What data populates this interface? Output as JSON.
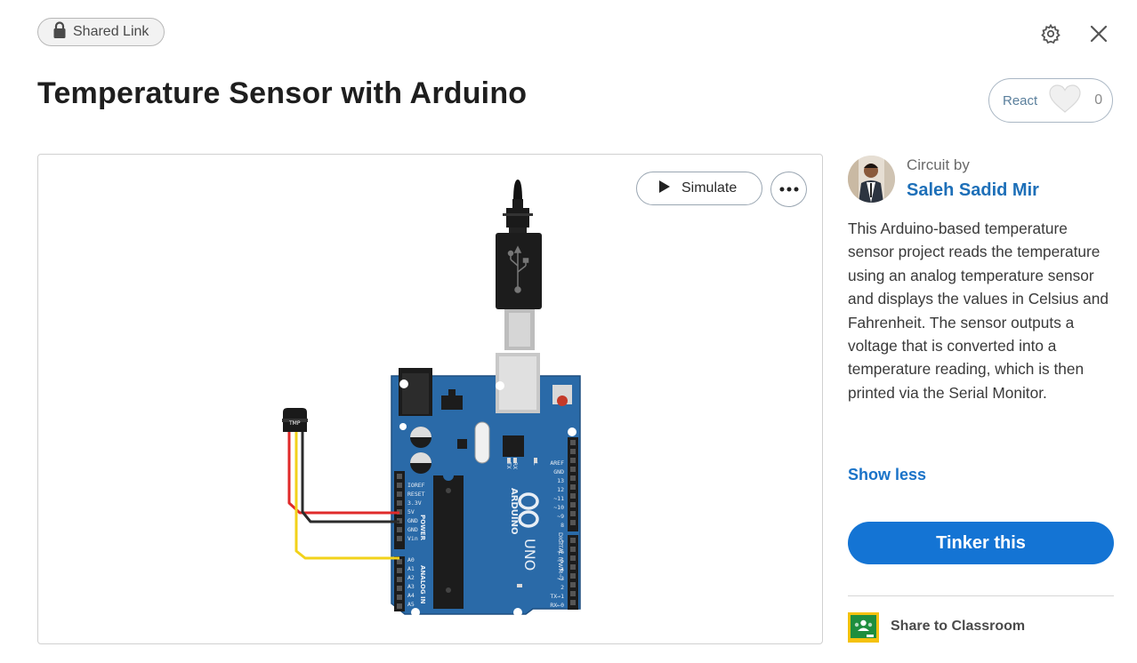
{
  "header": {
    "shared_label": "Shared Link",
    "title": "Temperature Sensor with Arduino",
    "react_label": "React",
    "react_count": "0"
  },
  "canvas": {
    "simulate_label": "Simulate",
    "sensor_label": "TMP",
    "board_brand": "ARDUINO",
    "board_model": "UNO",
    "power_header_label": "POWER",
    "analog_header_label": "ANALOG IN",
    "digital_header_label": "DIGITAL (PWM~)",
    "left_pins": [
      "IOREF",
      "RESET",
      "3.3V",
      "5V",
      "GND",
      "GND",
      "Vin"
    ],
    "analog_pins": [
      "A0",
      "A1",
      "A2",
      "A3",
      "A4",
      "A5"
    ],
    "digital_pins": [
      "AREF",
      "GND",
      "13",
      "12",
      "~11",
      "~10",
      "~9",
      "8",
      "7",
      "~6",
      "~5",
      "4",
      "~3",
      "2",
      "TX→1",
      "RX←0"
    ],
    "led_labels": [
      "TX",
      "RX",
      "L"
    ]
  },
  "sidebar": {
    "circuit_by": "Circuit by",
    "author": "Saleh Sadid Mir",
    "description": "This Arduino-based temperature sensor project reads the temperature using an analog temperature sensor and displays the values in Celsius and Fahrenheit. The sensor outputs a voltage that is converted into a temperature reading, which is then printed via the Serial Monitor.",
    "show_less": "Show less",
    "tinker_label": "Tinker this",
    "share_classroom": "Share to Classroom"
  },
  "colors": {
    "accent": "#1474d4",
    "author_link": "#1d6fb8",
    "board": "#2a6aa8",
    "wire_red": "#e02a2a",
    "wire_black": "#2b2b2b",
    "wire_yellow": "#f2d21a"
  },
  "icons": [
    "lock-icon",
    "settings-icon",
    "close-icon",
    "heart-icon",
    "play-icon",
    "more-icon",
    "classroom-icon"
  ]
}
